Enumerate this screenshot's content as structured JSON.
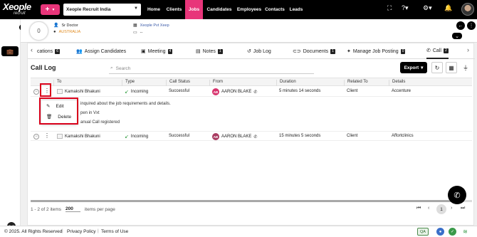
{
  "topbar": {
    "logo": "Xeople",
    "logo_sub": "recruit",
    "company": "Xeople Recruit India",
    "nav": [
      "Home",
      "Clients",
      "Jobs",
      "Candidates",
      "Employees",
      "Contacts",
      "Leads"
    ],
    "active_nav": "Jobs",
    "brand_color": "#e8357a"
  },
  "header": {
    "count": "0",
    "title": "Sr Doctor",
    "location": "AUSTRALIA",
    "company_link": "Xeople Pvt Xeep",
    "sub_line": "--"
  },
  "tabs": [
    {
      "label": "cations",
      "badge": "6",
      "icon": "none"
    },
    {
      "label": "Assign Candidates",
      "badge": "",
      "icon": "people-icon"
    },
    {
      "label": "Meeting",
      "badge": "4",
      "icon": "calendar-icon"
    },
    {
      "label": "Notes",
      "badge": "1",
      "icon": "note-icon"
    },
    {
      "label": "Job Log",
      "badge": "",
      "icon": "history-icon"
    },
    {
      "label": "Documents",
      "badge": "1",
      "icon": "link-icon"
    },
    {
      "label": "Manage Job Posting",
      "badge": "0",
      "icon": "sparkle-icon"
    },
    {
      "label": "Call",
      "badge": "2",
      "icon": "phone-icon"
    }
  ],
  "calllog": {
    "title": "Call Log",
    "search_placeholder": "Search",
    "export_label": "Export",
    "columns": [
      "To",
      "Type",
      "Call Status",
      "From",
      "Duration",
      "Related To",
      "Details"
    ],
    "rows": [
      {
        "to": "Kamakshi Bhakuni",
        "type": "Incoming",
        "status": "Successful",
        "from_initials": "AB",
        "from": "AARON BLAKE",
        "duration": "5 minutes 14 seconds",
        "related": "Client",
        "details": "Accenture"
      },
      {
        "to": "Kamakshi Bhakuni",
        "type": "Incoming",
        "status": "Successful",
        "from_initials": "AB",
        "from": "AARON BLAKE",
        "duration": "15 minutes 5 seconds",
        "related": "Client",
        "details": "Affortclinics"
      }
    ],
    "detail_lines": [
      "inquired about the job requirements and details.",
      "pen in Vxt",
      "anual Call registered"
    ],
    "context_menu": {
      "edit": "Edit",
      "delete": "Delete"
    }
  },
  "pager": {
    "range": "1 - 2 of 2 items",
    "page_size": "200",
    "per_page": "items per page",
    "current_page": "1"
  },
  "footer": {
    "copyright": "© 2025. All Rights Reserved",
    "privacy": "Privacy Policy",
    "terms": "Terms of Use",
    "qa": "QA"
  }
}
